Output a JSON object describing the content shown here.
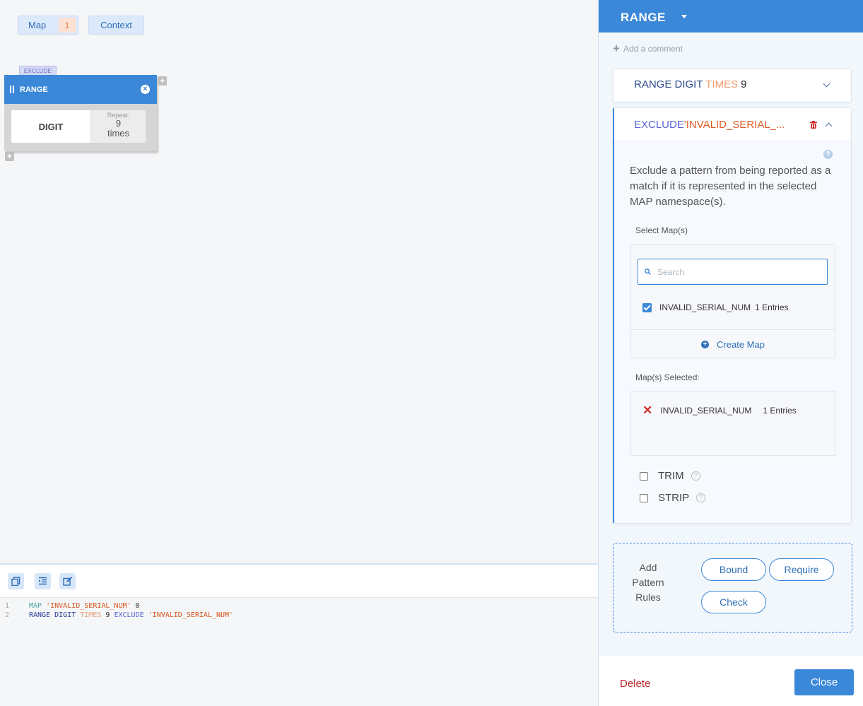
{
  "canvas": {
    "map_tab": {
      "label": "Map",
      "count": "1"
    },
    "context_tab": {
      "label": "Context"
    },
    "block": {
      "exclude_tag": "EXCLUDE",
      "title": "RANGE",
      "digit": "DIGIT",
      "repeat_label": "Repeat:",
      "repeat_value": "9",
      "repeat_unit": "times"
    }
  },
  "editor": {
    "lines": [
      {
        "num": "1",
        "tokens": {
          "kw": "MAP",
          "str": "'INVALID_SERIAL_NUM'",
          "num": "0"
        }
      },
      {
        "num": "2",
        "tokens": {
          "kw": "RANGE DIGIT",
          "times": "TIMES",
          "num": "9",
          "excl": "EXCLUDE",
          "str": "'INVALID_SERIAL_NUM'"
        }
      }
    ]
  },
  "panel": {
    "title": "RANGE",
    "add_comment": "Add a comment",
    "range_section": {
      "kw": "RANGE DIGIT",
      "times": "TIMES",
      "num": "9"
    },
    "exclude_section": {
      "kw": "EXCLUDE",
      "str": "'INVALID_SERIAL_...",
      "description": "Exclude a pattern from being reported as a match if it is represented in the selected MAP namespace(s).",
      "select_label": "Select Map(s)",
      "search_placeholder": "Search",
      "map_option": {
        "name": "INVALID_SERIAL_NUM",
        "entries": "1 Entries",
        "checked": true
      },
      "create_map": "Create Map",
      "selected_label": "Map(s) Selected:",
      "selected_item": {
        "name": "INVALID_SERIAL_NUM",
        "entries": "1 Entries"
      },
      "trim_label": "TRIM",
      "strip_label": "STRIP"
    },
    "pattern_rules": {
      "label": "Add Pattern Rules",
      "bound": "Bound",
      "require": "Require",
      "check": "Check"
    },
    "footer": {
      "delete": "Delete",
      "close": "Close"
    }
  },
  "colors": {
    "accent": "#3b88d8",
    "danger": "#c0272d",
    "string": "#d4531c",
    "keyword_exclude": "#5a66d6"
  }
}
